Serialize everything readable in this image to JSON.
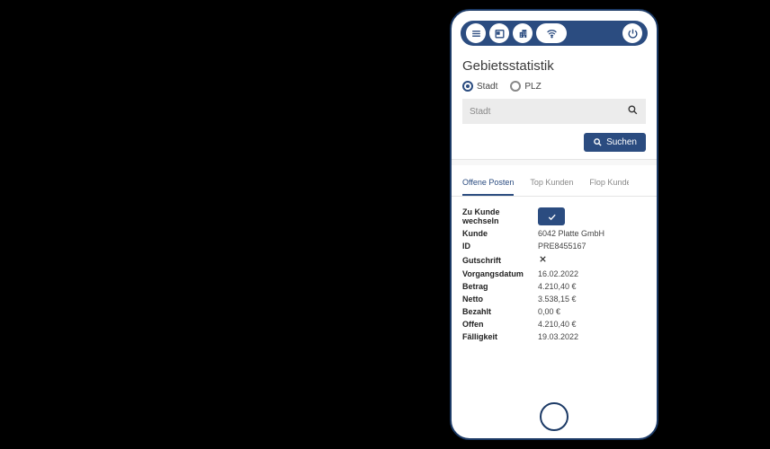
{
  "header": {
    "title": "Gebietsstatistik"
  },
  "filter": {
    "radio_stadt": "Stadt",
    "radio_plz": "PLZ",
    "placeholder": "Stadt",
    "search_btn": "Suchen"
  },
  "tabs": {
    "offene_posten": "Offene Posten",
    "top_kunden": "Top Kunden",
    "flop_kunden": "Flop Kunden"
  },
  "detail": {
    "zu_kunde_label": "Zu Kunde wechseln",
    "rows": [
      {
        "label": "Kunde",
        "value": "6042 Platte GmbH"
      },
      {
        "label": "ID",
        "value": "PRE8455167"
      },
      {
        "label": "Gutschrift",
        "value": "__X__"
      },
      {
        "label": "Vorgangsdatum",
        "value": "16.02.2022"
      },
      {
        "label": "Betrag",
        "value": "4.210,40 €"
      },
      {
        "label": "Netto",
        "value": "3.538,15 €"
      },
      {
        "label": "Bezahlt",
        "value": "0,00 €"
      },
      {
        "label": "Offen",
        "value": "4.210,40 €"
      },
      {
        "label": "Fälligkeit",
        "value": "19.03.2022"
      }
    ]
  }
}
